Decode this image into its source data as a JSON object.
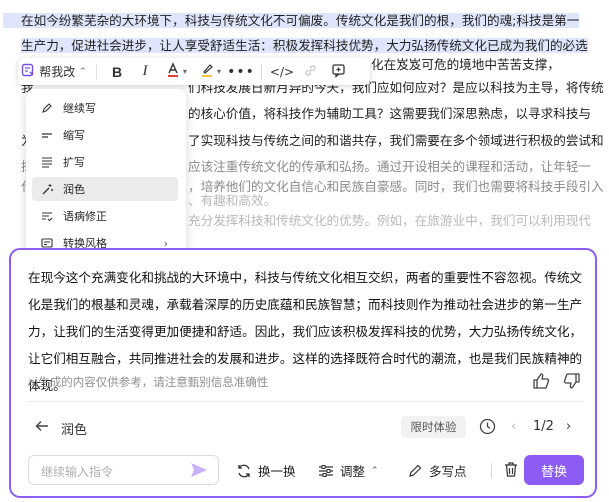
{
  "document": {
    "line1": "在如今纷繁芜杂的大环境下，科技与传统文化不可偏废。传统文化是我们的根，我们的魂;科技是第一",
    "line2": "生产力，促进社会进步，让人享受舒适生活：积极发挥科技优势，大力弘扬传统文化已成为我们的必选",
    "line3_tail": "化在岌岌可危的境地中苦苦支撑，",
    "line4_start": "我",
    "line4_mid": "们科技发展日新月异的今天，我们应如何应对？是应以科技为主导，将传统",
    "line5_mid": "的核心价值，将科技作为辅助工具？这需要我们深思熟虑，以寻求科技与",
    "line6_start": "为",
    "line6_mid": "了实现科技与传统之间的和谐共存，我们需要在多个领域进行积极的尝试和",
    "line7_start": "探",
    "line7_mid": "应该注重传统文化的传承和弘扬。通过开设相关的课程和活动，让年轻一",
    "line8_start": "代",
    "line8_mid": "，培养他们的文化自信心和民族自豪感。同时，我们也需要将科技手段引入",
    "line9_mid": "、有趣和高效。",
    "line10_mid": "充分发挥科技和传统文化的优势。例如，在旅游业中，我们可以利用现代"
  },
  "toolbar": {
    "help_label": "帮我改"
  },
  "menu": {
    "items": [
      {
        "label": "继续写",
        "icon": "pen-icon"
      },
      {
        "label": "缩写",
        "icon": "shorten-icon"
      },
      {
        "label": "扩写",
        "icon": "expand-icon"
      },
      {
        "label": "润色",
        "icon": "magic-wand-icon"
      },
      {
        "label": "语病修正",
        "icon": "grammar-fix-icon"
      },
      {
        "label": "转换风格",
        "icon": "style-convert-icon"
      }
    ]
  },
  "result": {
    "text": "在现今这个充满变化和挑战的大环境中，科技与传统文化相互交织，两者的重要性不容忽视。传统文化是我们的根基和灵魂，承载着深厚的历史底蕴和民族智慧；而科技则作为推动社会进步的第一生产力，让我们的生活变得更加便捷和舒适。因此，我们应该积极发挥科技的优势，大力弘扬传统文化，让它们相互融合，共同推进社会的发展和进步。这样的选择既符合时代的潮流，也是我们民族精神的体现。",
    "disclaimer": "ai生成的内容仅供参考，请注意甄别信息准确性"
  },
  "footer": {
    "back_label": "润色",
    "trial_badge": "限时体验",
    "page_indicator": "1/2",
    "prompt_placeholder": "继续输入指令",
    "regenerate_label": "换一换",
    "adjust_label": "调整",
    "write_more_label": "多写点",
    "replace_label": "替换"
  },
  "colors": {
    "accent": "#8c5cf5",
    "selection": "#dfe6fb"
  }
}
